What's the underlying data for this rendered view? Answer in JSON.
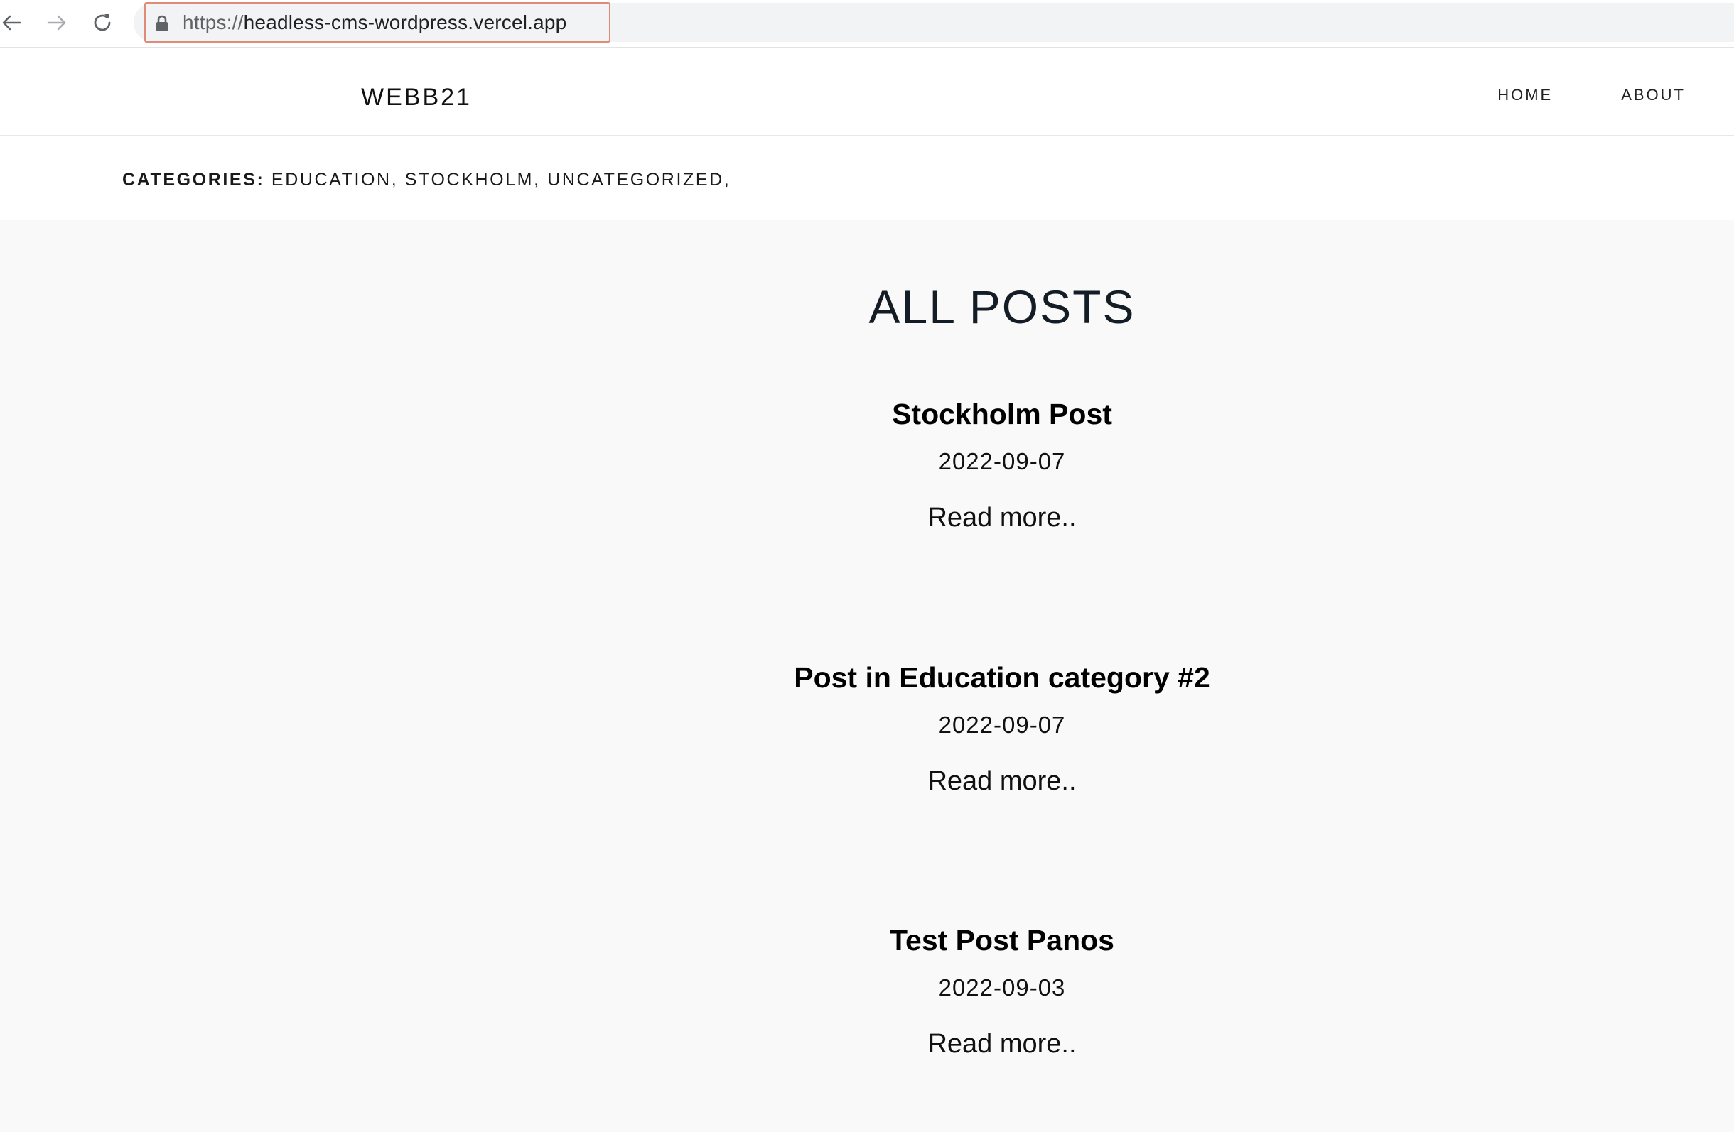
{
  "browser": {
    "url_scheme": "https://",
    "url_host": "headless-cms-wordpress.vercel.app"
  },
  "header": {
    "logo": "WEBB21",
    "nav": [
      {
        "label": "HOME"
      },
      {
        "label": "ABOUT"
      }
    ]
  },
  "categories": {
    "label": "CATEGORIES:",
    "items": [
      {
        "label": "EDUCATION,"
      },
      {
        "label": "STOCKHOLM,"
      },
      {
        "label": "UNCATEGORIZED,"
      }
    ]
  },
  "main": {
    "title": "ALL POSTS",
    "posts": [
      {
        "title": "Stockholm Post",
        "date": "2022-09-07",
        "read_more": "Read more.."
      },
      {
        "title": "Post in Education category #2",
        "date": "2022-09-07",
        "read_more": "Read more.."
      },
      {
        "title": "Test Post Panos",
        "date": "2022-09-03",
        "read_more": "Read more.."
      }
    ]
  },
  "colors": {
    "url_highlight_border": "#e08a7a",
    "omnibox_bg": "#f1f3f4",
    "content_bg": "#f9f9f9",
    "title_color": "#141c26"
  }
}
